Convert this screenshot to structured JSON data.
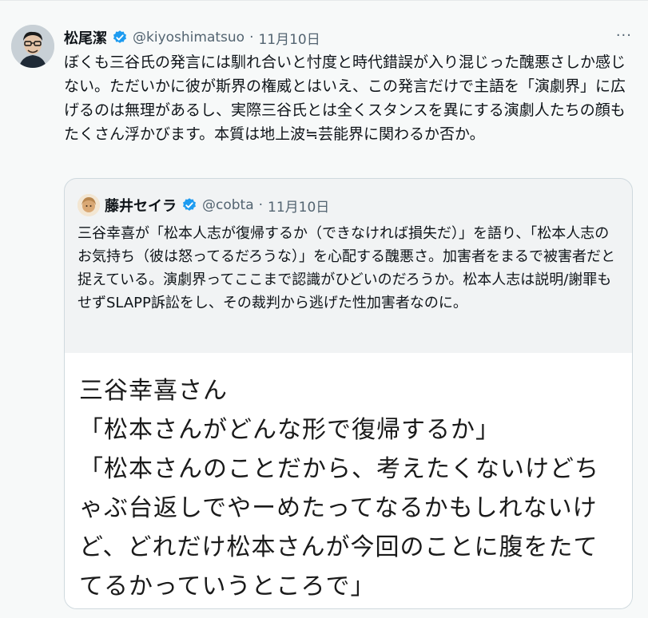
{
  "tweet": {
    "display_name": "松尾潔",
    "handle": "@kiyoshimatsuo",
    "separator": "·",
    "date": "11月10日",
    "more": "···",
    "text": "ぼくも三谷氏の発言には馴れ合いと忖度と時代錯誤が入り混じった醜悪さしか感じない。ただいかに彼が斯界の権威とはいえ、この発言だけで主語を「演劇界」に広げるのは無理があるし、実際三谷氏とは全くスタンスを異にする演劇人たちの顔もたくさん浮かびます。本質は地上波≒芸能界に関わるか否か。"
  },
  "quote": {
    "display_name": "藤井セイラ",
    "handle": "@cobta",
    "separator": "·",
    "date": "11月10日",
    "text": "三谷幸喜が「松本人志が復帰するか（できなければ損失だ）」を語り、「松本人志のお気持ち（彼は怒ってるだろうな）」を心配する醜悪さ。加害者をまるで被害者だと捉えている。演劇界ってここまで認識がひどいのだろうか。松本人志は説明/謝罪もせずSLAPP訴訟をし、その裁判から逃げた性加害者なのに。",
    "media_lines": [
      "三谷幸喜さん",
      "「松本さんがどんな形で復帰するか」",
      "「松本さんのことだから、考えたくないけどち",
      "ゃぶ台返しでやーめたってなるかもしれないけ",
      "ど、どれだけ松本さんが今回のことに腹をたて",
      "てるかっていうところで」"
    ]
  },
  "colors": {
    "verified": "#1d9bf0",
    "secondary_text": "#536471",
    "border": "#cfd9de"
  }
}
